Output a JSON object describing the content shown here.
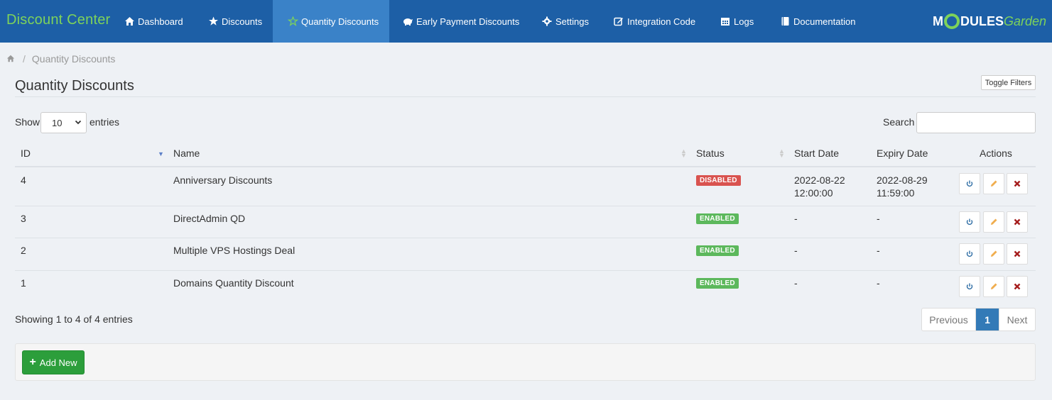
{
  "app": {
    "brand": "Discount Center",
    "logo_main": "M",
    "logo_rest": "DULES",
    "logo_garden": "Garden"
  },
  "nav": [
    {
      "label": "Dashboard",
      "icon": "home-icon"
    },
    {
      "label": "Discounts",
      "icon": "star-icon"
    },
    {
      "label": "Quantity Discounts",
      "icon": "star-outline-icon",
      "active": true
    },
    {
      "label": "Early Payment Discounts",
      "icon": "piggy-bank-icon"
    },
    {
      "label": "Settings",
      "icon": "gear-icon"
    },
    {
      "label": "Integration Code",
      "icon": "edit-icon"
    },
    {
      "label": "Logs",
      "icon": "calendar-icon"
    },
    {
      "label": "Documentation",
      "icon": "book-icon"
    }
  ],
  "breadcrumb": {
    "home_icon": "home-icon",
    "separator": "/",
    "current": "Quantity Discounts"
  },
  "page": {
    "title": "Quantity Discounts",
    "toggle_filters": "Toggle Filters"
  },
  "table_controls": {
    "show_label": "Show",
    "entries_value": "10",
    "entries_label": "entries",
    "search_label": "Search",
    "search_value": ""
  },
  "table": {
    "headers": [
      "ID",
      "Name",
      "Status",
      "Start Date",
      "Expiry Date",
      "Actions"
    ],
    "rows": [
      {
        "id": "4",
        "name": "Anniversary Discounts",
        "status": "DISABLED",
        "start_date": "2022-08-22",
        "start_time": "12:00:00",
        "expiry_date": "2022-08-29",
        "expiry_time": "11:59:00"
      },
      {
        "id": "3",
        "name": "DirectAdmin QD",
        "status": "ENABLED",
        "start_date": "-",
        "start_time": "",
        "expiry_date": "-",
        "expiry_time": ""
      },
      {
        "id": "2",
        "name": "Multiple VPS Hostings Deal",
        "status": "ENABLED",
        "start_date": "-",
        "start_time": "",
        "expiry_date": "-",
        "expiry_time": ""
      },
      {
        "id": "1",
        "name": "Domains Quantity Discount",
        "status": "ENABLED",
        "start_date": "-",
        "start_time": "",
        "expiry_date": "-",
        "expiry_time": ""
      }
    ]
  },
  "footer": {
    "info": "Showing 1 to 4 of 4 entries",
    "prev": "Previous",
    "page": "1",
    "next": "Next",
    "add_new": "Add New"
  },
  "colors": {
    "nav_bg": "#1d5fa6",
    "nav_active": "#3a82c8",
    "brand": "#7ed35a",
    "disabled": "#d9534f",
    "enabled": "#5cb85c",
    "add_button": "#2c9e3b"
  }
}
